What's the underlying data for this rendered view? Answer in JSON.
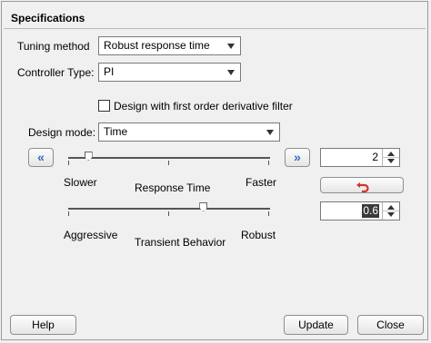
{
  "section": {
    "title": "Specifications"
  },
  "tuning_method": {
    "label": "Tuning method",
    "value": "Robust response time"
  },
  "controller_type": {
    "label": "Controller Type:",
    "value": "PI"
  },
  "derivative_filter": {
    "label": "Design with first order derivative filter",
    "checked": false
  },
  "design_mode": {
    "label": "Design mode:",
    "value": "Time"
  },
  "nav": {
    "left_glyph": "«",
    "right_glyph": "»"
  },
  "response_time": {
    "left_label": "Slower",
    "center_label": "Response Time",
    "right_label": "Faster",
    "slider_fraction": 0.1,
    "spin_value": "2"
  },
  "transient_behavior": {
    "left_label": "Aggressive",
    "center_label": "Transient Behavior",
    "right_label": "Robust",
    "slider_fraction": 0.67,
    "spin_value": "0.6"
  },
  "reset": {
    "icon": "undo-arrow-icon"
  },
  "buttons": {
    "help": "Help",
    "update": "Update",
    "close": "Close"
  },
  "colors": {
    "accent": "#2f6fc0",
    "reset_icon": "#d0342c"
  }
}
